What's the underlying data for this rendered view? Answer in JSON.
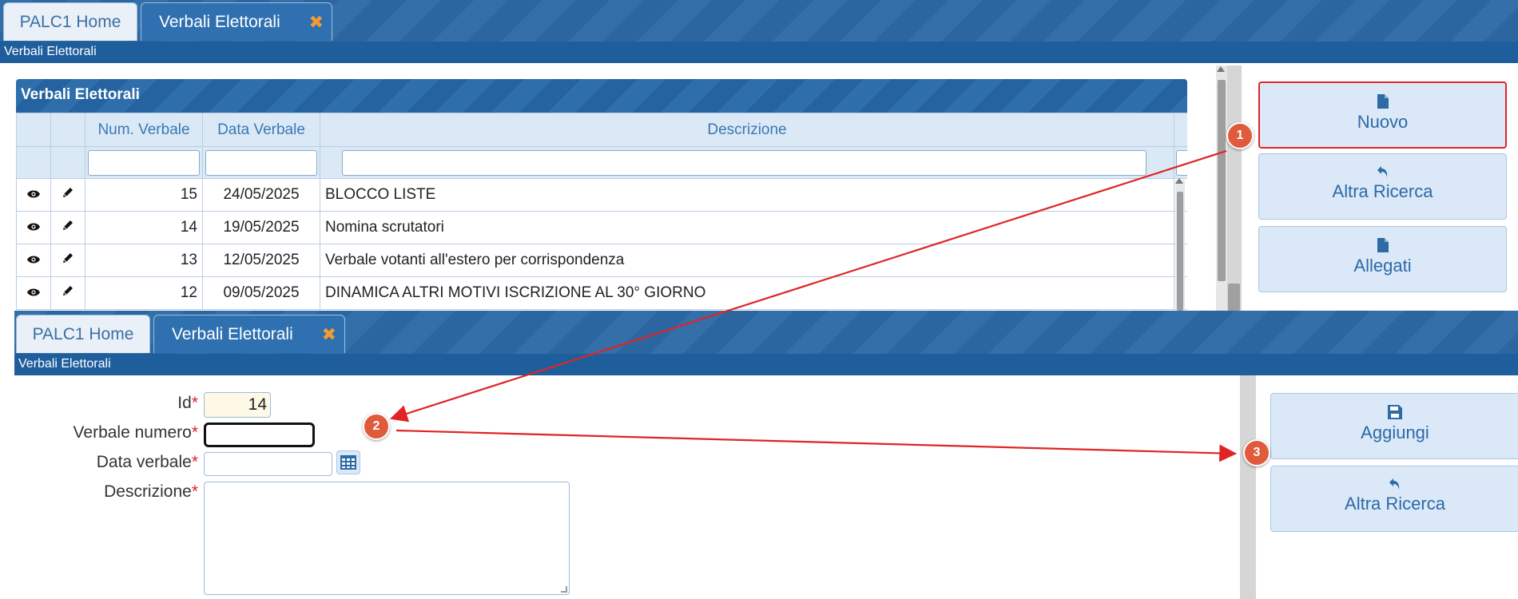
{
  "top": {
    "tabs": [
      {
        "label": "PALC1 Home"
      },
      {
        "label": "Verbali Elettorali",
        "close": "✖"
      }
    ],
    "subbar_title": "Verbali Elettorali",
    "panel_title": "Verbali Elettorali",
    "table": {
      "columns": [
        "",
        "",
        "Num. Verbale",
        "Data Verbale",
        "Descrizione"
      ],
      "rows": [
        {
          "num": "15",
          "date": "24/05/2025",
          "desc": "BLOCCO LISTE"
        },
        {
          "num": "14",
          "date": "19/05/2025",
          "desc": "Nomina scrutatori"
        },
        {
          "num": "13",
          "date": "12/05/2025",
          "desc": "Verbale votanti all'estero per corrispondenza"
        },
        {
          "num": "12",
          "date": "09/05/2025",
          "desc": "DINAMICA ALTRI MOTIVI ISCRIZIONE AL 30° GIORNO"
        }
      ]
    },
    "buttons": {
      "nuovo": "Nuovo",
      "altra_ricerca": "Altra Ricerca",
      "allegati": "Allegati"
    }
  },
  "bottom": {
    "tabs": [
      {
        "label": "PALC1 Home"
      },
      {
        "label": "Verbali Elettorali",
        "close": "✖"
      }
    ],
    "subbar_title": "Verbali Elettorali",
    "form": {
      "id_label": "Id",
      "id_value": "14",
      "verbale_numero_label": "Verbale numero",
      "data_verbale_label": "Data verbale",
      "descrizione_label": "Descrizione",
      "required_mark": "*"
    },
    "buttons": {
      "aggiungi": "Aggiungi",
      "altra_ricerca": "Altra Ricerca"
    }
  },
  "annotations": {
    "step1": "1",
    "step2": "2",
    "step3": "3"
  },
  "colors": {
    "accent": "#2d6aa6",
    "annotation": "#e02424",
    "badge": "#e05a3c"
  }
}
